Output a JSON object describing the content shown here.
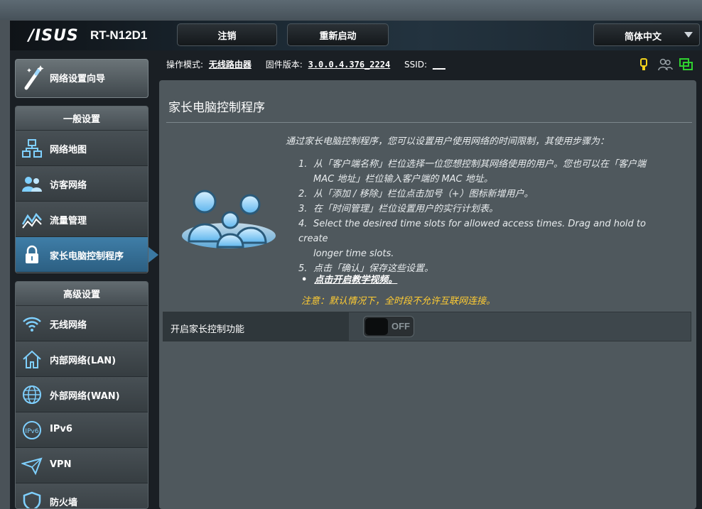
{
  "header": {
    "logo": "/ISUS",
    "model": "RT-N12D1",
    "logout_label": "注销",
    "reboot_label": "重新启动",
    "language": "简体中文"
  },
  "status_bar": {
    "mode_label": "操作模式:",
    "mode_value": "无线路由器",
    "firmware_label": "固件版本:",
    "firmware_value": "3.0.0.4.376_2224",
    "ssid_label": "SSID:",
    "ssid_value": "___"
  },
  "sidebar": {
    "wizard": "网络设置向导",
    "general_header": "一般设置",
    "general_items": [
      {
        "label": "网络地图",
        "icon": "network-map-icon"
      },
      {
        "label": "访客网络",
        "icon": "guest-network-icon"
      },
      {
        "label": "流量管理",
        "icon": "traffic-manager-icon"
      },
      {
        "label": "家长电脑控制程序",
        "icon": "lock-icon"
      }
    ],
    "advanced_header": "高级设置",
    "advanced_items": [
      {
        "label": "无线网络",
        "icon": "wifi-icon"
      },
      {
        "label": "内部网络(LAN)",
        "icon": "home-icon"
      },
      {
        "label": "外部网络(WAN)",
        "icon": "globe-icon"
      },
      {
        "label": "IPv6",
        "icon": "ipv6-icon"
      },
      {
        "label": "VPN",
        "icon": "vpn-icon"
      },
      {
        "label": "防火墙",
        "icon": "shield-icon"
      }
    ]
  },
  "main": {
    "title": "家长电脑控制程序",
    "description": "通过家长电脑控制程序，您可以设置用户使用网络的时间限制，其使用步骤为：",
    "steps": [
      {
        "num": "1.",
        "lines": [
          "从「客户端名称」栏位选择一位您想控制其网络使用的用户。您也可以在「客户端",
          "MAC 地址」栏位输入客户端的 MAC 地址。"
        ]
      },
      {
        "num": "2.",
        "lines": [
          "从「添加 / 移除」栏位点击加号（+）图标新增用户。"
        ]
      },
      {
        "num": "3.",
        "lines": [
          "在「时间管理」栏位设置用户的实行计划表。"
        ]
      },
      {
        "num": "4.",
        "lines": [
          "Select the desired time slots for allowed access times. Drag and hold to create",
          "longer time slots."
        ]
      },
      {
        "num": "5.",
        "lines": [
          "点击「确认」保存这些设置。"
        ]
      }
    ],
    "tutorial_link": "点击开启教学视频。",
    "note": "注意：默认情况下，全时段不允许互联网连接。",
    "setting_label": "开启家长控制功能",
    "toggle_state": "OFF"
  },
  "colors": {
    "accent_blue": "#3f7ea8",
    "note_yellow": "#ffcc33",
    "panel": "#4f585d"
  }
}
